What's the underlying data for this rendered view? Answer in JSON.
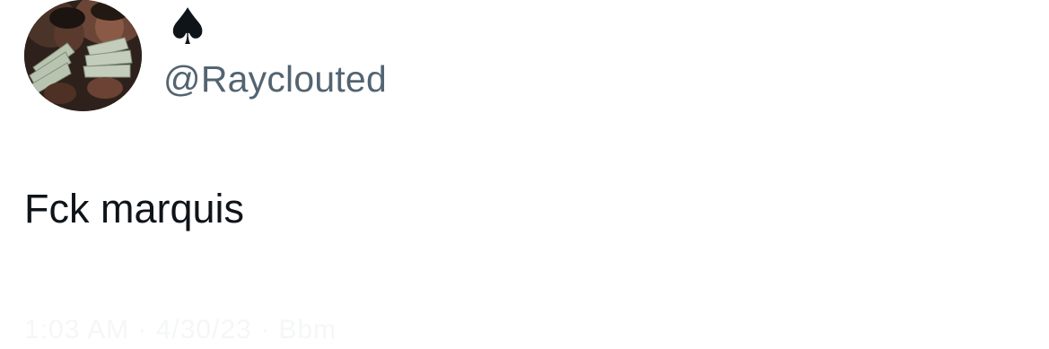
{
  "author": {
    "display_name": "♠",
    "handle": "@Rayclouted",
    "avatar_icon": "avatar-photo"
  },
  "tweet": {
    "text": "Fck marquis",
    "meta_text": "1:03 AM · 4/30/23 · Bbm"
  },
  "colors": {
    "text_primary": "#0f1419",
    "text_secondary": "#536471",
    "background": "#ffffff"
  }
}
